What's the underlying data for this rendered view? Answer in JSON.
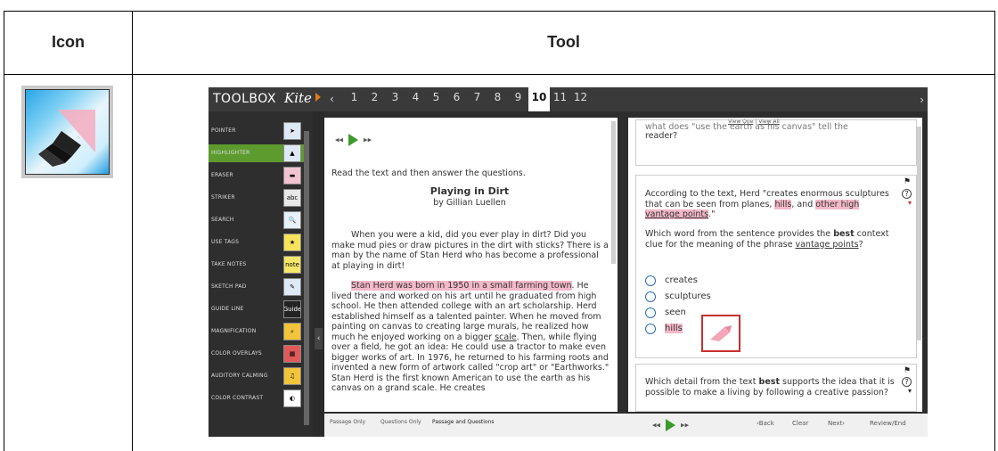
{
  "table": {
    "header_icon": "Icon",
    "header_tool": "Tool"
  },
  "icon": {
    "name": "highlighter-icon"
  },
  "app": {
    "title": "TOOLBOX",
    "logo": "Kite",
    "pages": [
      "1",
      "2",
      "3",
      "4",
      "5",
      "6",
      "7",
      "8",
      "9",
      "10",
      "11",
      "12"
    ],
    "active_page": "10",
    "tools": [
      {
        "label": "POINTER",
        "icon": "pointer-icon",
        "glyph": "➤",
        "active": false
      },
      {
        "label": "HIGHLIGHTER",
        "icon": "highlighter-icon",
        "glyph": "▲",
        "active": true
      },
      {
        "label": "ERASER",
        "icon": "eraser-icon",
        "glyph": "▬",
        "active": false
      },
      {
        "label": "STRIKER",
        "icon": "striker-icon",
        "glyph": "abc",
        "active": false
      },
      {
        "label": "SEARCH",
        "icon": "search-icon",
        "glyph": "🔍",
        "active": false
      },
      {
        "label": "USE TAGS",
        "icon": "tags-icon",
        "glyph": "★",
        "active": false
      },
      {
        "label": "TAKE NOTES",
        "icon": "notes-icon",
        "glyph": "note",
        "active": false
      },
      {
        "label": "SKETCH PAD",
        "icon": "sketch-pad-icon",
        "glyph": "✎",
        "active": false
      },
      {
        "label": "GUIDE LINE",
        "icon": "guide-line-icon",
        "glyph": "Guide",
        "active": false
      },
      {
        "label": "MAGNIFICATION",
        "icon": "magnification-icon",
        "glyph": "⌕",
        "active": false
      },
      {
        "label": "COLOR OVERLAYS",
        "icon": "color-overlays-icon",
        "glyph": "▦",
        "active": false
      },
      {
        "label": "AUDITORY CALMING",
        "icon": "auditory-calming-icon",
        "glyph": "♫",
        "active": false
      },
      {
        "label": "COLOR CONTRAST",
        "icon": "color-contrast-icon",
        "glyph": "◐",
        "active": false
      }
    ],
    "passage": {
      "instruction": "Read the text and then answer the questions.",
      "title": "Playing in Dirt",
      "byline": "by Gillian Luellen",
      "para1": "When you were a kid, did you ever play in dirt? Did you make mud pies or draw pictures in the dirt with sticks? There is a man by the name of Stan Herd who has become a professional at playing in dirt!",
      "para2_highlighted": "Stan Herd was born in 1950 in a small farming town",
      "para2_after": ". He lived there and worked on his art until he graduated from high school. He then attended college with an art scholarship. Herd established himself as a talented painter. When he moved from painting on canvas to creating large murals, he realized how much he enjoyed working on a bigger ",
      "para2_scale": "scale",
      "para2_rest": ". Then, while flying over a field, he got an idea: He could use a tractor to make even bigger works of art. In 1976, he returned to his farming roots and invented a new form of artwork called \"crop art\" or \"Earthworks.\" Stan Herd is the first known American to use the earth as his canvas on a grand scale. He creates"
    },
    "questions": {
      "view_one": "View One",
      "view_sep": "|",
      "view_all": "View All",
      "q_prev_top": "what does \"use the earth as his canvas\" tell the",
      "q_prev_bottom": "reader?",
      "q_main_1": "According to the text, Herd \"creates enormous sculptures that can be seen from planes, ",
      "q_main_hills": "hills",
      "q_main_2": ", and ",
      "q_main_other": "other high ",
      "q_main_vantage": "vantage points",
      "q_main_end": ".\"",
      "q_stem_1": "Which word from the sentence provides the ",
      "q_stem_best": "best",
      "q_stem_2": " context clue for the meaning of the phrase ",
      "q_stem_vp": "vantage points",
      "q_stem_end": "?",
      "options": [
        "creates",
        "sculptures",
        "seen",
        "hills"
      ],
      "q_next_1": "Which detail from the text ",
      "q_next_best": "best",
      "q_next_2": " supports the idea that it is possible to make a living by following a creative passion?"
    },
    "bottom": {
      "tabs": [
        "Passage Only",
        "Questions Only",
        "Passage and Questions"
      ],
      "back": "‹Back",
      "clear": "Clear",
      "next": "Next›",
      "review": "Review/End"
    }
  }
}
